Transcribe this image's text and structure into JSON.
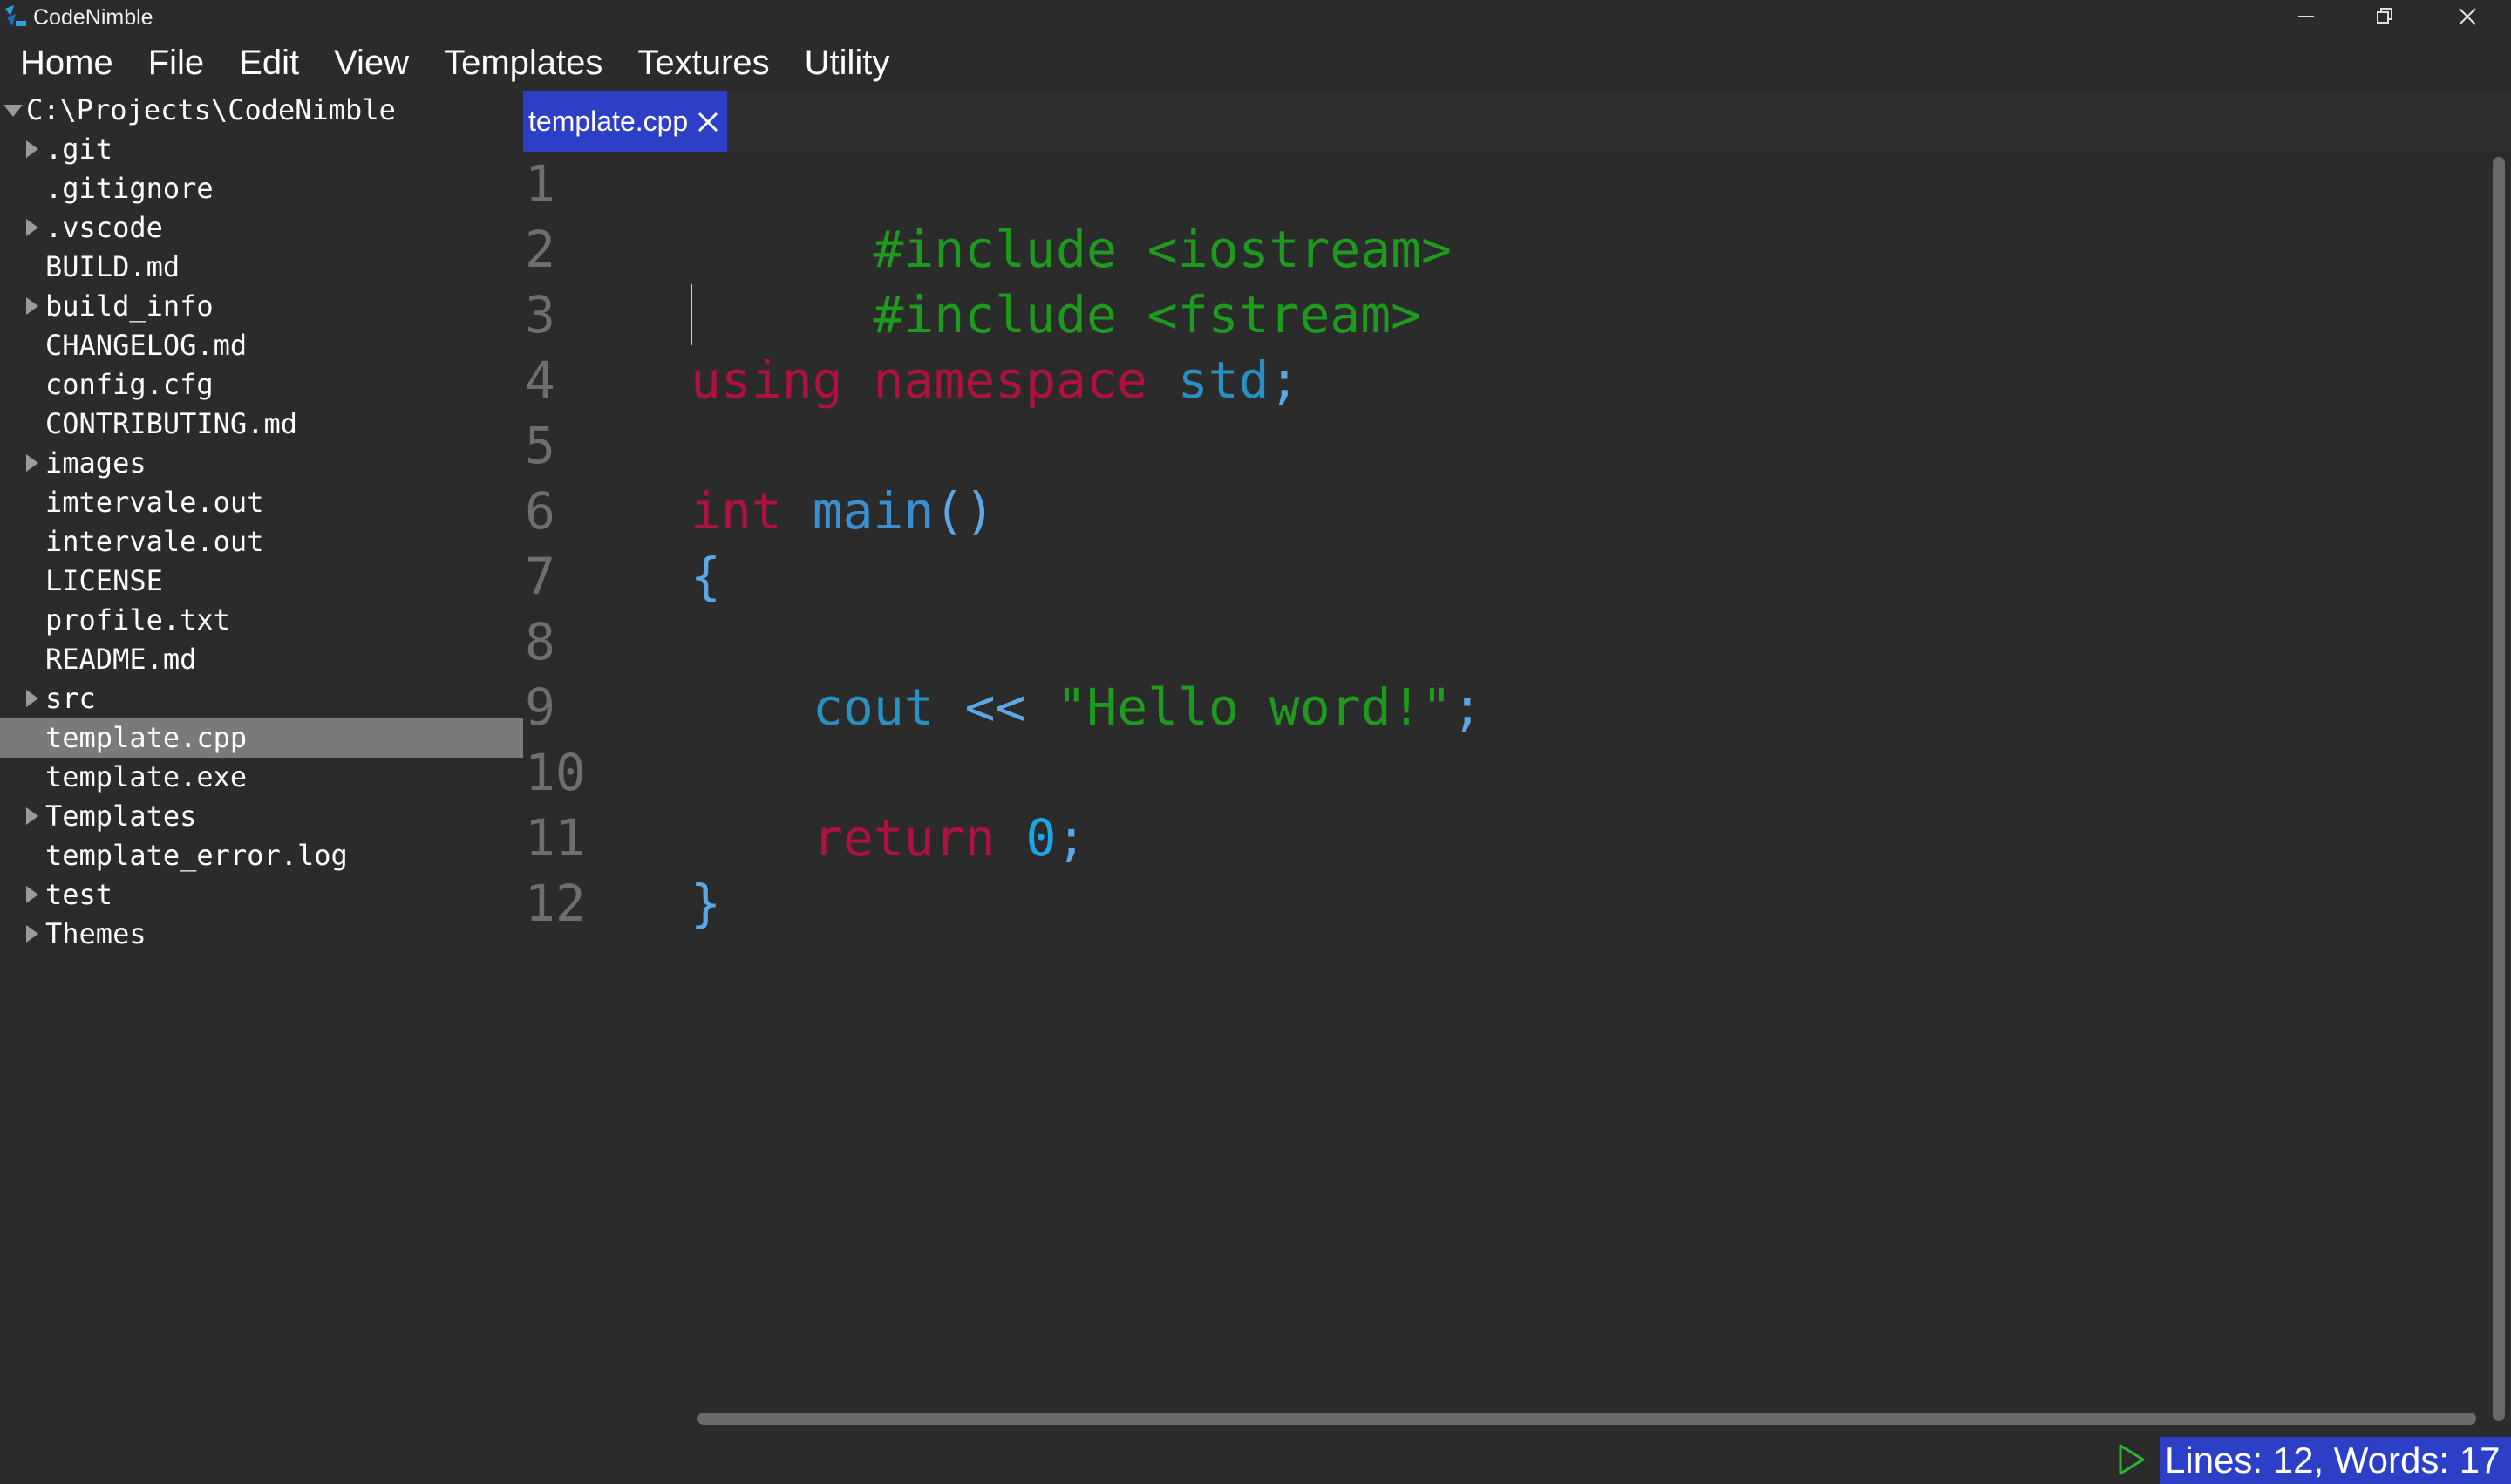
{
  "window": {
    "title": "CodeNimble",
    "logo_icon": "codenimble-logo-icon",
    "controls": [
      "minimize-icon",
      "restore-icon",
      "close-icon"
    ]
  },
  "menu": [
    "Home",
    "File",
    "Edit",
    "View",
    "Templates",
    "Textures",
    "Utility"
  ],
  "sidebar": {
    "root": "C:\\Projects\\CodeNimble",
    "items": [
      {
        "label": ".git",
        "type": "folder"
      },
      {
        "label": ".gitignore",
        "type": "file"
      },
      {
        "label": ".vscode",
        "type": "folder"
      },
      {
        "label": "BUILD.md",
        "type": "file"
      },
      {
        "label": "build_info",
        "type": "folder"
      },
      {
        "label": "CHANGELOG.md",
        "type": "file"
      },
      {
        "label": "config.cfg",
        "type": "file"
      },
      {
        "label": "CONTRIBUTING.md",
        "type": "file"
      },
      {
        "label": "images",
        "type": "folder"
      },
      {
        "label": "imtervale.out",
        "type": "file"
      },
      {
        "label": "intervale.out",
        "type": "file"
      },
      {
        "label": "LICENSE",
        "type": "file"
      },
      {
        "label": "profile.txt",
        "type": "file"
      },
      {
        "label": "README.md",
        "type": "file"
      },
      {
        "label": "src",
        "type": "folder"
      },
      {
        "label": "template.cpp",
        "type": "file",
        "selected": true
      },
      {
        "label": "template.exe",
        "type": "file"
      },
      {
        "label": "Templates",
        "type": "folder"
      },
      {
        "label": "template_error.log",
        "type": "file"
      },
      {
        "label": "test",
        "type": "folder"
      },
      {
        "label": "Themes",
        "type": "folder"
      }
    ]
  },
  "tab": {
    "label": "template.cpp",
    "close_icon": "close-icon"
  },
  "editor": {
    "line_numbers": [
      "1",
      "2",
      "3",
      "4",
      "5",
      "6",
      "7",
      "8",
      "9",
      "10",
      "11",
      "12"
    ],
    "code": {
      "l1_pre": "#include <iostream>",
      "l2_pre": "#include <fstream>",
      "l4_kw1": "using",
      "l4_kw2": "namespace",
      "l4_id": "std",
      "l4_semi": ";",
      "l6_type": "int",
      "l6_fn": "main",
      "l6_paren": "()",
      "l7_brace": "{",
      "l9_id": "cout",
      "l9_op": "<<",
      "l9_str": "\"Hello word!\"",
      "l9_semi": ";",
      "l11_kw": "return",
      "l11_num": "0",
      "l11_semi": ";",
      "l12_brace": "}"
    }
  },
  "status": {
    "run_icon": "play-icon",
    "text": "Lines: 12, Words: 17"
  },
  "colors": {
    "background": "#2b2b2b",
    "accent": "#2e3fc7",
    "selection": "#7a7a7a",
    "preprocessor": "#1e9b1e",
    "keyword": "#b0123f",
    "identifier": "#2a8fc1",
    "number": "#1aa7e8",
    "run_button": "#2db52d"
  }
}
